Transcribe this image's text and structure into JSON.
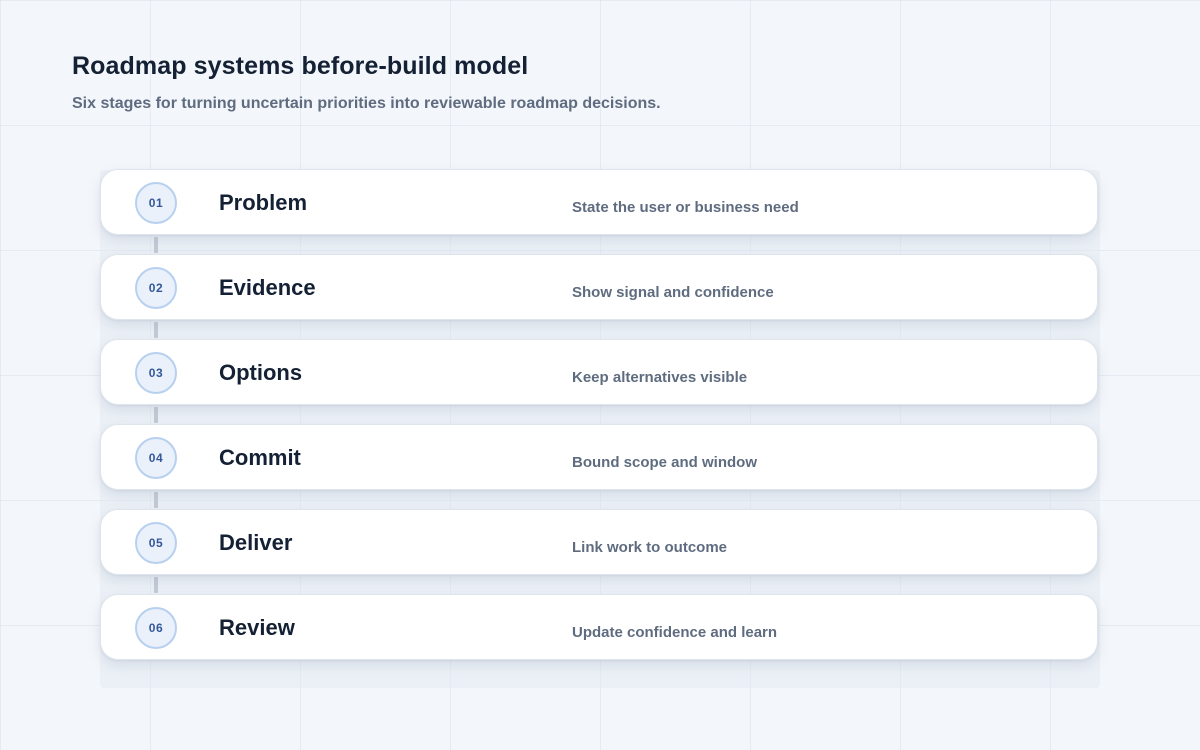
{
  "header": {
    "title": "Roadmap systems before-build model",
    "subtitle": "Six stages for turning uncertain priorities into reviewable roadmap decisions."
  },
  "stages": [
    {
      "number": "01",
      "name": "Problem",
      "description": "State the user or business need"
    },
    {
      "number": "02",
      "name": "Evidence",
      "description": "Show signal and confidence"
    },
    {
      "number": "03",
      "name": "Options",
      "description": "Keep alternatives visible"
    },
    {
      "number": "04",
      "name": "Commit",
      "description": "Bound scope and window"
    },
    {
      "number": "05",
      "name": "Deliver",
      "description": "Link work to outcome"
    },
    {
      "number": "06",
      "name": "Review",
      "description": "Update confidence and learn"
    }
  ],
  "colors": {
    "title": "#142033",
    "muted_text": "#5f6c80",
    "badge_fill": "#eaf1fb",
    "badge_border": "#b8d0ef",
    "badge_text": "#34589a",
    "connector": "#c4cad4"
  }
}
